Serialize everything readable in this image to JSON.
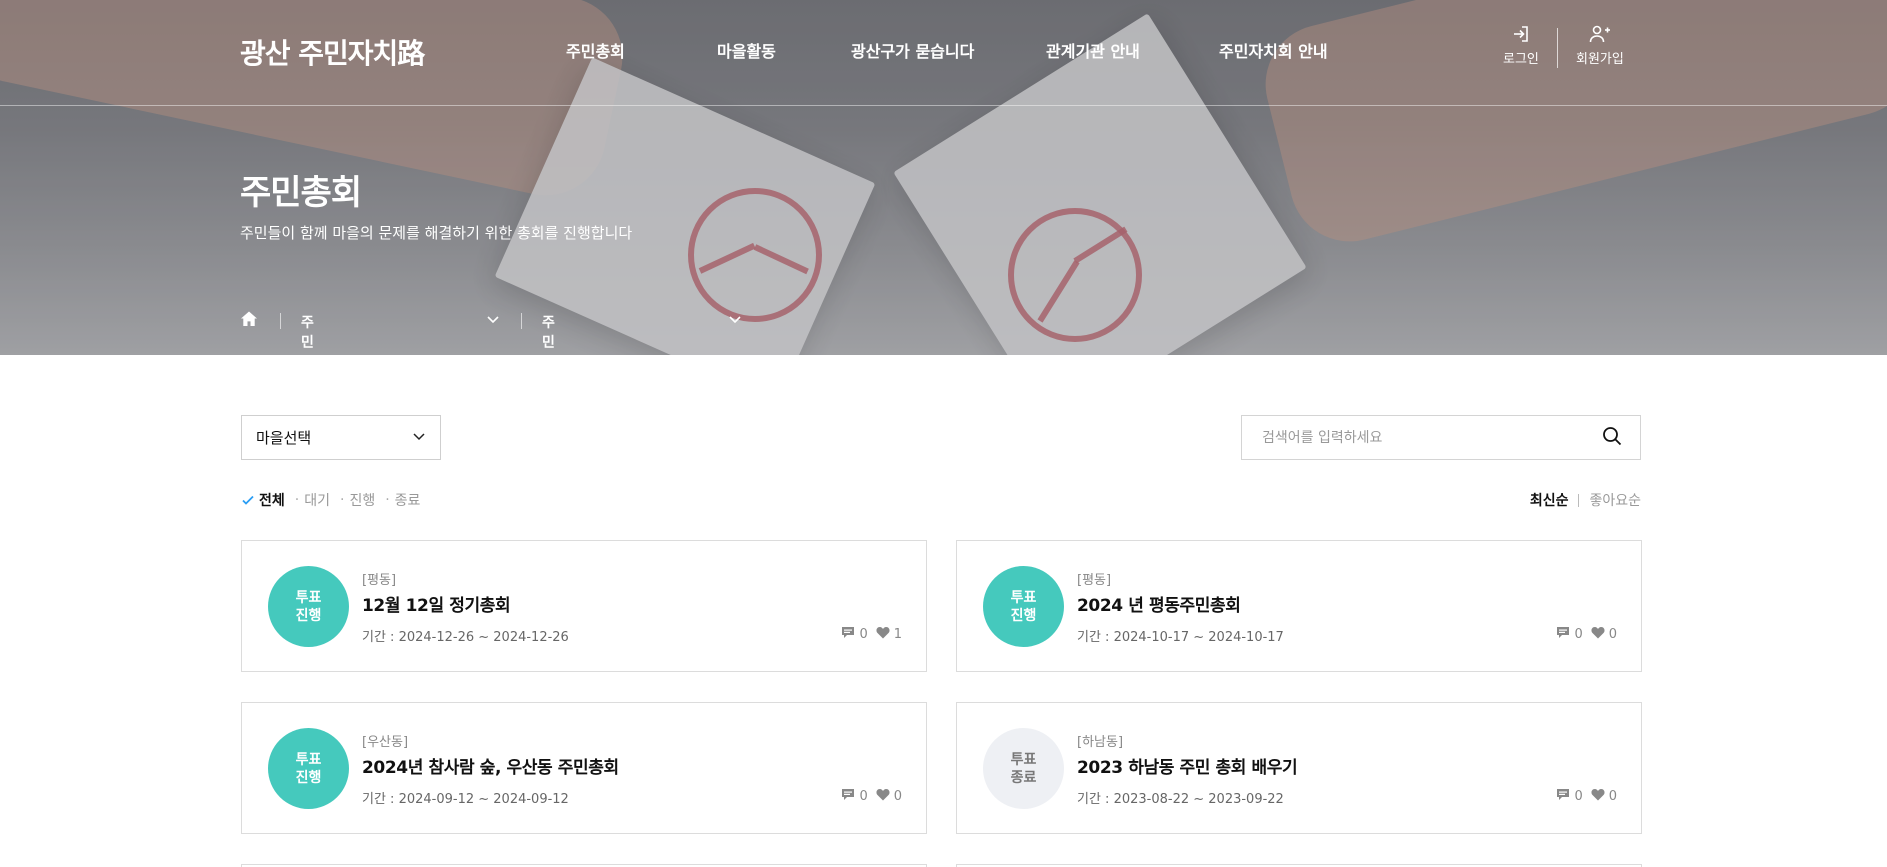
{
  "header": {
    "logo": "광산 주민자치路",
    "nav": [
      "주민총회",
      "마을활동",
      "광산구가 묻습니다",
      "관계기관 안내",
      "주민자치회 안내"
    ],
    "login_label": "로그인",
    "signup_label": "회원가입"
  },
  "hero": {
    "title": "주민총회",
    "description": "주민들이 함께 마을의 문제를 해결하기 위한 총회를 진행합니다"
  },
  "breadcrumb": {
    "level1": "주민총회",
    "level2": "주민총회"
  },
  "filters": {
    "village_select": "마을선택",
    "search_placeholder": "검색어를 입력하세요",
    "status": [
      "전체",
      "대기",
      "진행",
      "종료"
    ],
    "active_status": "전체",
    "sort": [
      "최신순",
      "좋아요순"
    ],
    "active_sort": "최신순"
  },
  "cards": [
    {
      "badge_line1": "투표",
      "badge_line2": "진행",
      "status": "진행",
      "location": "[평동]",
      "title": "12월 12일 정기총회",
      "period": "기간 : 2024-12-26 ~ 2024-12-26",
      "comments": "0",
      "likes": "1"
    },
    {
      "badge_line1": "투표",
      "badge_line2": "진행",
      "status": "진행",
      "location": "[평동]",
      "title": "2024 년 평동주민총회",
      "period": "기간 : 2024-10-17 ~ 2024-10-17",
      "comments": "0",
      "likes": "0"
    },
    {
      "badge_line1": "투표",
      "badge_line2": "진행",
      "status": "진행",
      "location": "[우산동]",
      "title": "2024년 참사람 숲, 우산동 주민총회",
      "period": "기간 : 2024-09-12 ~ 2024-09-12",
      "comments": "0",
      "likes": "0"
    },
    {
      "badge_line1": "투표",
      "badge_line2": "종료",
      "status": "종료",
      "location": "[하남동]",
      "title": "2023 하남동 주민 총회 배우기",
      "period": "기간 : 2023-08-22 ~ 2023-09-22",
      "comments": "0",
      "likes": "0"
    }
  ],
  "colors": {
    "badge_active": "#45c9bd",
    "badge_ended": "#eef0f4",
    "check_accent": "#2a9df4"
  },
  "icons": {
    "home": "home-icon",
    "login": "login-icon",
    "signup": "user-plus-icon",
    "search": "search-icon",
    "comment": "comment-icon",
    "like": "heart-icon",
    "check": "check-icon",
    "chevron": "chevron-down-icon"
  }
}
